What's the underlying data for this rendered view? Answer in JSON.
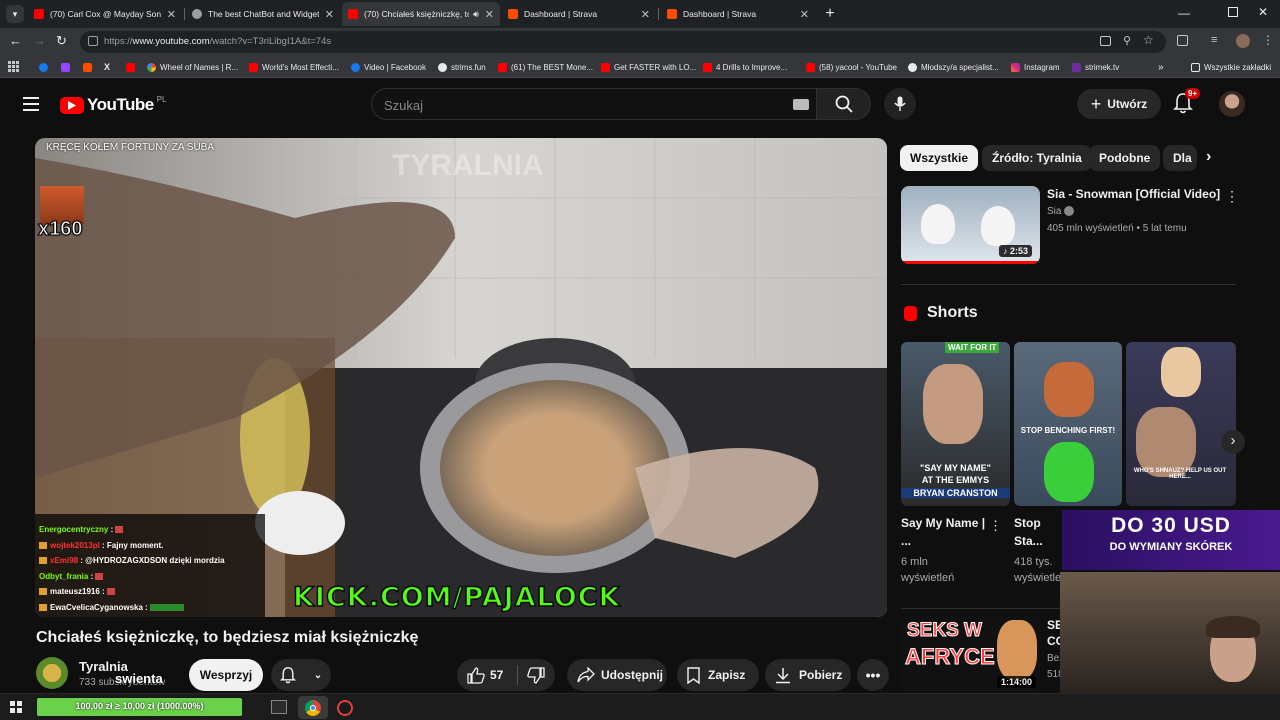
{
  "browser": {
    "tabs": [
      {
        "title": "(70) Carl Cox @ Mayday Sonic I",
        "favicon_color": "#ff0000"
      },
      {
        "title": "The best ChatBot and Widgets",
        "favicon_color": "#9aa0a6"
      },
      {
        "title": "(70) Chciałeś księżniczkę, to",
        "favicon_color": "#ff0000",
        "active": true
      },
      {
        "title": "Dashboard | Strava",
        "favicon_color": "#fc4c02"
      },
      {
        "title": "Dashboard | Strava",
        "favicon_color": "#fc4c02"
      }
    ],
    "url_prefix": "https://",
    "url_domain": "www.youtube.com",
    "url_path": "/watch?v=T3riLibgI1A&t=74s",
    "bookmarks": [
      {
        "label": "",
        "color": "#1877f2"
      },
      {
        "label": "",
        "color": "#9146ff"
      },
      {
        "label": "",
        "color": "#fc4c02"
      },
      {
        "label": "",
        "color": "#e8eaed"
      },
      {
        "label": "",
        "color": "#ff0000"
      },
      {
        "label": "Wheel of Names | R...",
        "color": "#f4b400"
      },
      {
        "label": "World's Most Effecti...",
        "color": "#ff0000"
      },
      {
        "label": "Video | Facebook",
        "color": "#1877f2"
      },
      {
        "label": "strims.fun",
        "color": "#e8eaed"
      },
      {
        "label": "(61) The BEST Mone...",
        "color": "#ff0000"
      },
      {
        "label": "Get FASTER with LO...",
        "color": "#ff0000"
      },
      {
        "label": "4 Drills to Improve...",
        "color": "#ff0000"
      },
      {
        "label": "(58) yacool - YouTube",
        "color": "#ff0000"
      },
      {
        "label": "Młodszy/a specjalist...",
        "color": "#e8eaed"
      },
      {
        "label": "Instagram",
        "color": "#e1306c"
      },
      {
        "label": "strimek.tv",
        "color": "#6b2fa0"
      }
    ],
    "all_bookmarks": "Wszystkie zakładki"
  },
  "youtube": {
    "logo_text": "YouTube",
    "region": "PL",
    "search_placeholder": "Szukaj",
    "create_label": "Utwórz",
    "notifications_badge": "9+"
  },
  "player": {
    "overlay_top": "KRĘCĘ KOŁEM FORTUNY ZA SUBA",
    "watermark": "TYRALNIA",
    "multiplier": "x160",
    "chat": [
      {
        "user": "Energocentryczny",
        "user_color": "#7cfc00",
        "text": ""
      },
      {
        "user": "wojtek2013pl",
        "user_color": "#ff3030",
        "text": "Fajny moment."
      },
      {
        "user": "xEmi98",
        "user_color": "#ff3030",
        "text": "@HYDROZAGXDSON dzięki mordzia"
      },
      {
        "user": "Odbyt_frania",
        "user_color": "#7cfc00",
        "text": ""
      },
      {
        "user": "mateusz1916",
        "user_color": "#ffffff",
        "text": ""
      },
      {
        "user": "EwaCvelicaCyganowska",
        "user_color": "#ffffff",
        "text": ""
      }
    ],
    "kick_text": "KICK.COM/PAJALOCK"
  },
  "video": {
    "title": "Chciałeś księżniczkę, to będziesz miał księżniczkę",
    "channel": "Tyralnia",
    "subscribers": "733 subskrybentów",
    "overlay_name": "swienta",
    "support_label": "Wesprzyj",
    "likes": "57",
    "share_label": "Udostępnij",
    "save_label": "Zapisz",
    "download_label": "Pobierz"
  },
  "sidebar": {
    "chips": [
      "Wszystkie",
      "Źródło: Tyralnia",
      "Podobne",
      "Dla"
    ],
    "recommended": {
      "title": "Sia - Snowman [Official Video]",
      "channel": "Sia",
      "meta": "405 mln wyświetleń • 5 lat temu",
      "duration": "2:53"
    },
    "shorts_heading": "Shorts",
    "shorts": [
      {
        "thumb_top": "WAIT FOR IT",
        "thumb_caption1": "\"SAY MY NAME\"",
        "thumb_caption2": "AT THE EMMYS",
        "thumb_caption3": "BRYAN CRANSTON",
        "title": "Say My Name | ...",
        "views": "6 mln wyświetleń"
      },
      {
        "thumb_caption1": "STOP BENCHING FIRST!",
        "title": "Stop Sta... Bench...",
        "views": "418 tys. wyświetleń"
      },
      {
        "thumb_caption1": "WHO'S SHNAUZ? HELP US OUT HERE...",
        "title": "",
        "views": ""
      }
    ],
    "next_video": {
      "thumb_text1": "SEKS W",
      "thumb_text2": "AFRYCE",
      "duration": "1:14:00",
      "title_frag": "SE CO",
      "meta_frag": "Bez 518"
    }
  },
  "stream_overlay": {
    "promo_line1": "DO 30 USD",
    "promo_line2": "DO WYMIANY SKÓREK",
    "goal": "100,00 zł ≥ 10,00 zł (1000.00%)"
  }
}
